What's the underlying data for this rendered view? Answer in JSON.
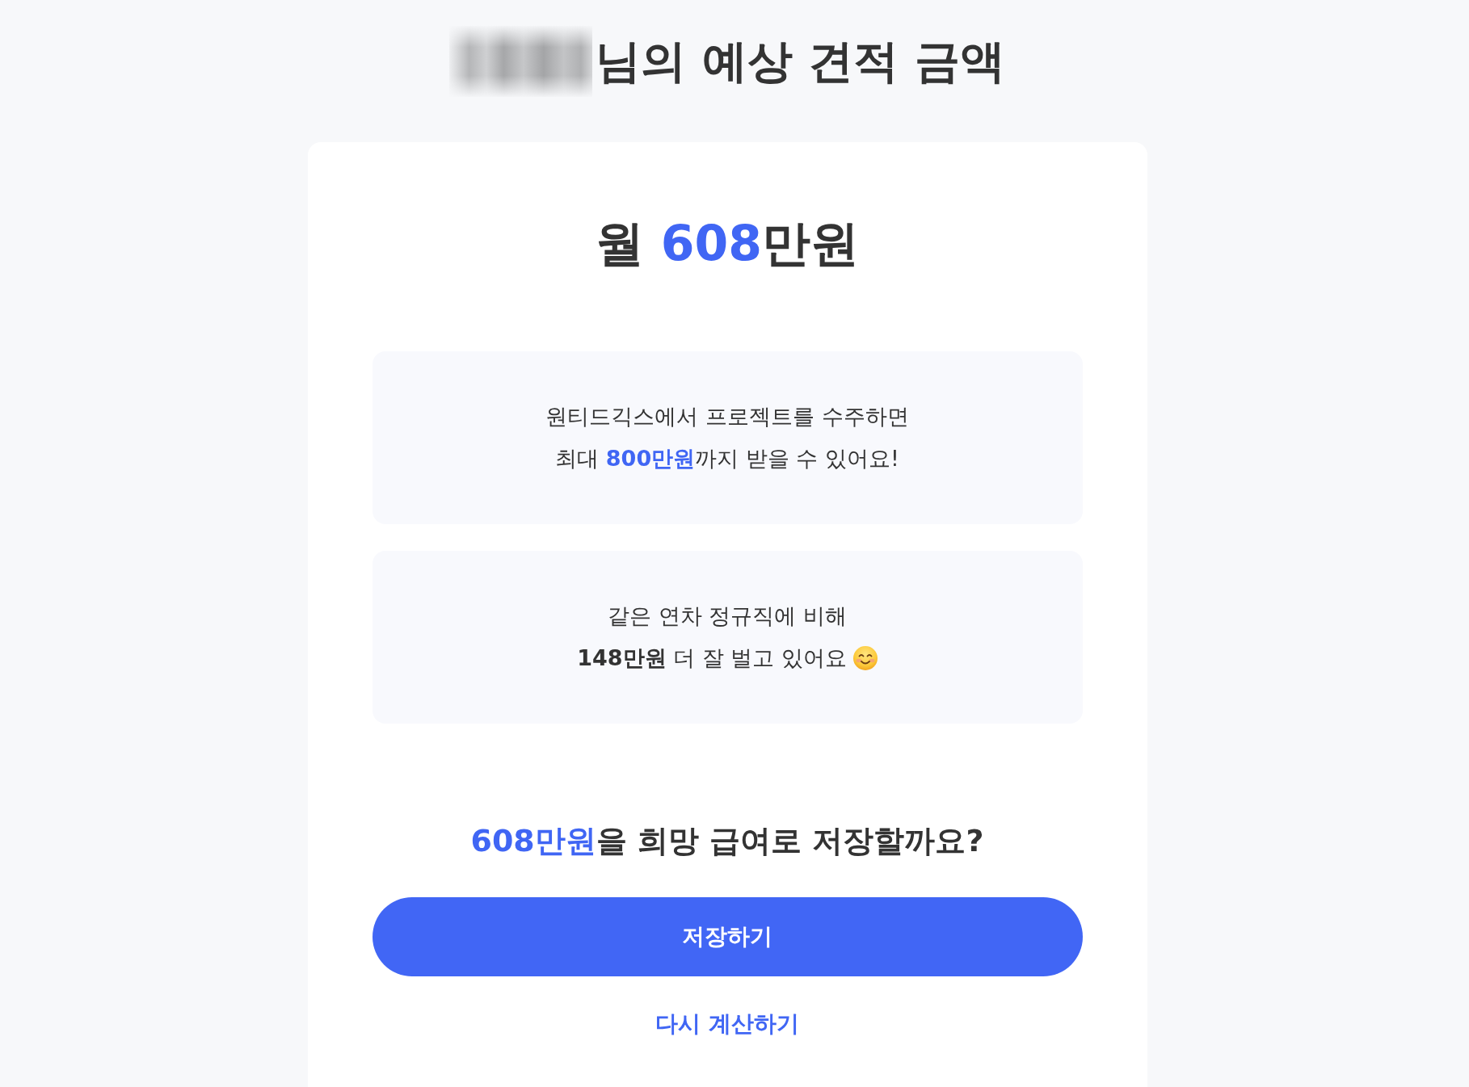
{
  "header": {
    "title": "님의 예상 견적 금액"
  },
  "estimate": {
    "segments": [
      {
        "text": "월 ",
        "highlight": false
      },
      {
        "text": "608",
        "highlight": true
      },
      {
        "text": "만원",
        "highlight": false
      }
    ]
  },
  "info_boxes": [
    {
      "lines": [
        {
          "kind": "plain",
          "segments": [
            {
              "text": "원티드긱스에서 프로젝트를 수주하면",
              "highlight": false
            }
          ]
        },
        {
          "kind": "plain",
          "segments": [
            {
              "text": "최대 ",
              "highlight": false
            },
            {
              "text": "800만원",
              "highlight": true
            },
            {
              "text": "까지 받을 수 있어요!",
              "highlight": false
            }
          ]
        }
      ]
    },
    {
      "lines": [
        {
          "kind": "plain",
          "segments": [
            {
              "text": "같은 연차 정규직에 비해",
              "highlight": false
            }
          ]
        },
        {
          "kind": "with_icon",
          "segments": [
            {
              "text": "**148만원** 더 잘 벌고 있어요",
              "highlight": false
            }
          ]
        }
      ]
    }
  ],
  "question": {
    "segments": [
      {
        "text": "608만원",
        "highlight": true
      },
      {
        "text": "을 희망 급여로 저장할까요?",
        "highlight": false
      }
    ]
  },
  "actions": [
    {
      "kind": "primary",
      "label": "저장하기"
    },
    {
      "kind": "link",
      "label": "다시 계산하기"
    }
  ]
}
